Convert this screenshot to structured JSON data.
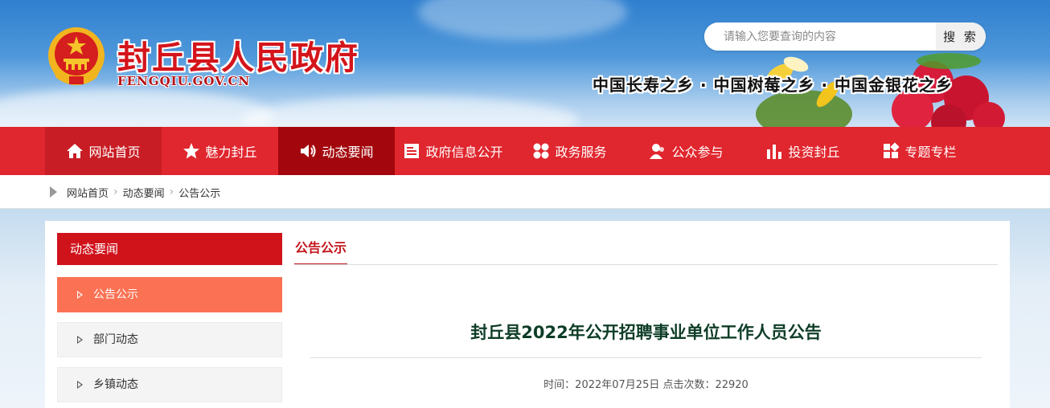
{
  "header": {
    "site_title": "封丘县人民政府",
    "site_domain": "FENGQIU.GOV.CN",
    "slogan": "中国长寿之乡 · 中国树莓之乡 · 中国金银花之乡",
    "search": {
      "placeholder": "请输入您要查询的内容",
      "button_label": "搜 索"
    }
  },
  "nav": {
    "items": [
      {
        "label": "网站首页",
        "icon": "home-icon"
      },
      {
        "label": "魅力封丘",
        "icon": "star-icon"
      },
      {
        "label": "动态要闻",
        "icon": "speaker-icon"
      },
      {
        "label": "政府信息公开",
        "icon": "document-icon"
      },
      {
        "label": "政务服务",
        "icon": "grid-icon"
      },
      {
        "label": "公众参与",
        "icon": "people-icon"
      },
      {
        "label": "投资封丘",
        "icon": "bar-chart-icon"
      },
      {
        "label": "专题专栏",
        "icon": "tiles-icon"
      }
    ],
    "active_label": "动态要闻"
  },
  "breadcrumb": [
    "网站首页",
    "动态要闻",
    "公告公示"
  ],
  "sidebar": {
    "title": "动态要闻",
    "items": [
      {
        "label": "公告公示",
        "active": true
      },
      {
        "label": "部门动态",
        "active": false
      },
      {
        "label": "乡镇动态",
        "active": false
      }
    ]
  },
  "content": {
    "tab_label": "公告公示",
    "article_title": "封丘县2022年公开招聘事业单位工作人员公告",
    "meta": "时间：2022年07月25日 点击次数：22920"
  },
  "colors": {
    "nav_bg": "#e0262e",
    "nav_active": "#a3070d",
    "accent_red": "#d0121b",
    "side_active": "#fa7153",
    "title_green": "#0e3d27"
  }
}
